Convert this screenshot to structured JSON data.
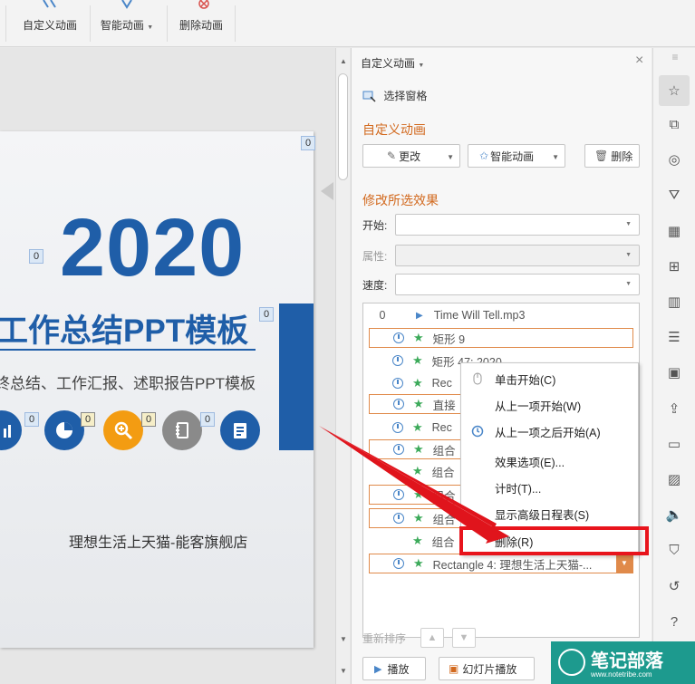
{
  "toolbar": {
    "custom_animation": "自定义动画",
    "smart_animation": "智能动画",
    "delete_animation": "删除动画"
  },
  "slide": {
    "year": "2020",
    "title": "工作总结PPT模板",
    "subtitle": "终总结、工作汇报、述职报告PPT模板",
    "store": "理想生活上天猫-能客旗舰店",
    "tags": [
      "0",
      "0",
      "0",
      "0",
      "0",
      "0",
      "0"
    ]
  },
  "pane": {
    "header": "自定义动画",
    "select_pane": "选择窗格",
    "section_custom": "自定义动画",
    "btn_change": "更改",
    "btn_smart": "智能动画",
    "btn_delete": "删除",
    "section_modify": "修改所选效果",
    "label_start": "开始:",
    "label_property": "属性:",
    "label_speed": "速度:",
    "list": [
      {
        "index": "0",
        "label": "Time Will Tell.mp3"
      },
      {
        "label": "矩形 9"
      },
      {
        "label": "矩形 47: 2020"
      },
      {
        "label": "Rec"
      },
      {
        "label": "直接"
      },
      {
        "label": "Rec"
      },
      {
        "label": "组合"
      },
      {
        "label": "组合"
      },
      {
        "label": "组合"
      },
      {
        "label": "组合"
      },
      {
        "label": "组合"
      },
      {
        "label": "Rectangle 4: 理想生活上天猫-..."
      }
    ],
    "reorder": "重新排序",
    "play": "播放",
    "slideshow": "幻灯片播放"
  },
  "context_menu": {
    "items": [
      "单击开始(C)",
      "从上一项开始(W)",
      "从上一项之后开始(A)",
      "效果选项(E)...",
      "计时(T)...",
      "显示高级日程表(S)",
      "删除(R)"
    ]
  },
  "watermark": {
    "main": "笔记部落",
    "url": "www.notetribe.com"
  },
  "colors": {
    "brand_blue": "#1f5ea8",
    "section_orange": "#d2691e",
    "highlight_red": "#e8141c"
  }
}
